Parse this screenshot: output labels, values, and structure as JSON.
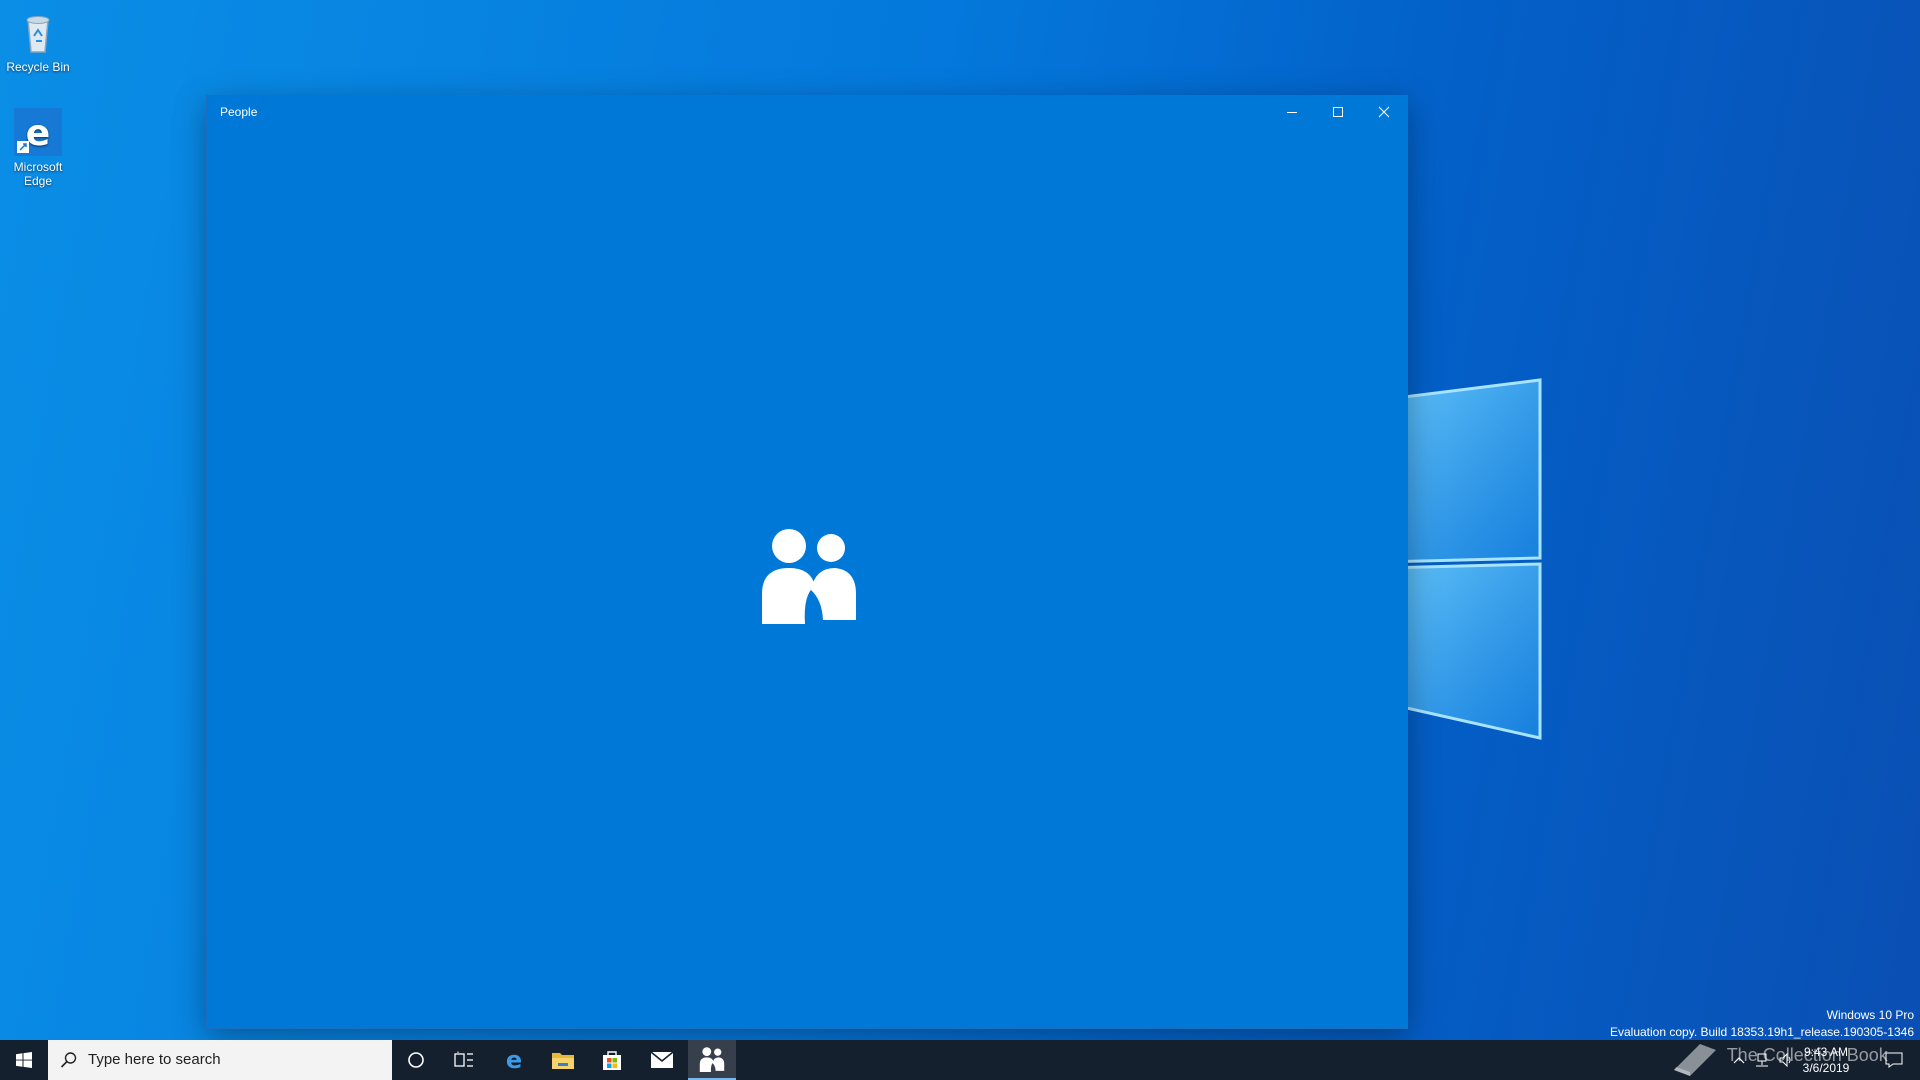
{
  "desktop": {
    "icons": [
      {
        "label": "Recycle Bin",
        "icon": "recycle-bin-icon"
      },
      {
        "label": "Microsoft Edge",
        "icon": "edge-icon"
      }
    ],
    "watermark": {
      "edition": "Windows 10 Pro",
      "build": "Evaluation copy. Build 18353.19h1_release.190305-1346"
    },
    "overlay_logo_text": "The Collection Book"
  },
  "window": {
    "title": "People",
    "controls": [
      "minimize",
      "maximize",
      "close"
    ],
    "background": "#0078d7",
    "splash_icon": "people-icon"
  },
  "taskbar": {
    "start_icon": "windows-start-icon",
    "search_placeholder": "Type here to search",
    "pinned": [
      {
        "name": "cortana",
        "icon": "cortana-circle-icon"
      },
      {
        "name": "task-view",
        "icon": "task-view-icon"
      },
      {
        "name": "edge",
        "icon": "edge-icon"
      },
      {
        "name": "file-explorer",
        "icon": "folder-icon"
      },
      {
        "name": "store",
        "icon": "store-icon"
      },
      {
        "name": "mail",
        "icon": "mail-icon"
      },
      {
        "name": "people",
        "icon": "people-icon",
        "active": true
      }
    ],
    "tray": {
      "time": "9:43 AM",
      "date": "3/6/2019"
    }
  },
  "colors": {
    "accent": "#0078d7",
    "taskbar": "#15202e"
  }
}
